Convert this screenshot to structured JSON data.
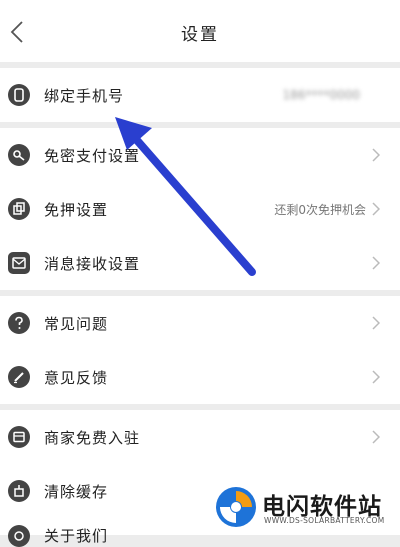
{
  "header": {
    "title": "设置"
  },
  "groups": [
    {
      "items": [
        {
          "label": "绑定手机号",
          "value": "186****0000",
          "icon": "phone-icon"
        }
      ]
    },
    {
      "items": [
        {
          "label": "免密支付设置",
          "icon": "key-icon"
        },
        {
          "label": "免押设置",
          "value": "还剩0次免押机会",
          "icon": "copy-icon"
        },
        {
          "label": "消息接收设置",
          "icon": "message-icon"
        }
      ]
    },
    {
      "items": [
        {
          "label": "常见问题",
          "icon": "question-icon"
        },
        {
          "label": "意见反馈",
          "icon": "pencil-icon"
        }
      ]
    },
    {
      "items": [
        {
          "label": "商家免费入驻",
          "icon": "store-icon"
        },
        {
          "label": "清除缓存",
          "icon": "broom-icon"
        },
        {
          "label": "关于我们",
          "icon": "info-icon"
        }
      ]
    }
  ],
  "watermark": {
    "name": "电闪软件站",
    "url": "WWW.DS-SOLARBATTERY.COM"
  },
  "colors": {
    "accent_arrow": "#2a3fcf",
    "background": "#ececec",
    "icon_dark": "#444444"
  }
}
